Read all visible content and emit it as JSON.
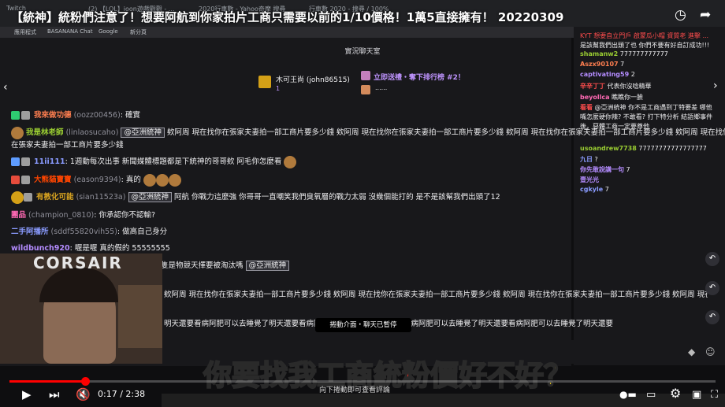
{
  "video": {
    "title": "【統神】統粉們注意了！想要阿航到你家拍片工商只需要以前的1/10價格！1萬5直接擁有！ 20220309",
    "caption_part1": "你要找我工商",
    "caption_red": "統粉",
    "caption_part2": "價好不好？",
    "subtitle": "向下捲動即可查看評論",
    "time_current": "0:17",
    "time_total": "2:38",
    "progress_fraction": 0.107,
    "brand": "CORSAIR",
    "accent": "#ff0000"
  },
  "browser": {
    "tabs": [
      "Twitch",
      "(2) 【LOL】ioon遊戲觀觀 - ...",
      "2020行車數 - Yahoo奇摩 搜尋",
      "行車數 2020 - 搜尋 / 100%"
    ],
    "bookmarks": [
      "應用程式",
      "BASANANA Chat",
      "Google",
      "新分頁"
    ]
  },
  "chat": {
    "header": "實況聊天室",
    "hype_name": "木可王尚 (john86515)",
    "hype_count": "1",
    "hype_cta": "立即送禮・奪下排行榜 #2！",
    "hype_more": "......",
    "paused_label": "捲動介面・聊天已暫停",
    "messages": [
      {
        "user": "我來做功德",
        "handle": "(oozz00456)",
        "text": ": 確實",
        "color": "#ff7f50"
      },
      {
        "user": "我是林老師",
        "handle": "(linlaosucaho)",
        "text": "欸阿周 現在找你在張家夫妻拍一部工商片要多少錢 欸阿周 現在找你在張家夫妻拍一部工商片要多少錢 欸阿周 現在找你在張家夫妻拍一部工商片要多少錢 欸阿周 現在找你",
        "mention": "@亞洲統神",
        "color": "#9acd32"
      },
      {
        "text2": "在張家夫妻拍一部工商片要多少錢"
      },
      {
        "user": "11ii111",
        "handle": "",
        "text": ": 1週動每次出事 新聞媒體標題都是下統神的哥哥欸 阿毛你怎麼看",
        "color": "#8a9bff"
      },
      {
        "user": "大熊貓寶寶",
        "handle": "(eason9394)",
        "text": ": 真的",
        "color": "#ff4500"
      },
      {
        "user": "有教化可能",
        "handle": "(sian11523a)",
        "text": "阿航 你戰力這麼強 你哥哥一直嘲笑我們臭氧層的戰力太弱 沒幾個能打的 是不是該幫我們出頭了12",
        "mention": "@亞洲統神",
        "color": "#daa520"
      },
      {
        "user": "團品",
        "handle": "(champion_0810)",
        "text": ": 你承認你不認輸?",
        "color": "#ff69b4"
      },
      {
        "user": "二手阿播所",
        "handle": "(sddf55820vih55)",
        "text": ": 做高自己身分",
        "color": "#8a9bff"
      },
      {
        "user": "wildbunch920",
        "handle": "",
        "text": ": 喔是喔 真的假的 55555555",
        "color": "#b48cff"
      },
      {
        "text3": "以精蟲剩8隻是物競天擇要被淘汰嗎",
        "mention": "@亞洲統神"
      },
      {
        "text4": "欸阿周 現在找你在張家夫妻拍一部工商片要多少錢 欸阿周 現在找你在張家夫妻拍一部工商片要多少錢 欸阿周 現在找你在張家夫妻拍一部工商片要多少錢 欸阿周 現在找"
      },
      {
        "text5": "明天還要看病阿肥可以去睡覺了明天還要看病阿肥可以去睡覺了明天還要看病阿肥可以去睡覺了明天還要看病阿肥可以去睡覺了明天還要"
      }
    ]
  },
  "right_chat": {
    "messages": [
      {
        "user": "",
        "text": "KYT 想要自立門戶 啟蒙瓜小帽 資質老 進擊 ...",
        "color": "#ff4d4d"
      },
      {
        "user": "",
        "text": "是該幫我們出頭了也 你們不要有好自訂成功!!!",
        "color": "#efeff1"
      },
      {
        "user": "shamanw2",
        "text": "777777777777",
        "color": "#9acd32"
      },
      {
        "user": "Aszx90107",
        "text": "7",
        "color": "#ff7f50"
      },
      {
        "user": "captivating59",
        "text": "2",
        "color": "#b48cff"
      },
      {
        "user": "辛辛丁丁",
        "text": "代表你沒唸精華",
        "color": "#ff4d4d"
      },
      {
        "user": "beyollca",
        "text": "瞧瞧你一臉",
        "color": "#ff69b4"
      },
      {
        "user": "看看",
        "text": "@亞洲統神 你不是工商遇到丁特要差 哪他嘴怎麼硬你辣? 不敢看? 打下特分析 結語鄉事件後，惡體工商一定要尊他",
        "color": "#ff4d4d"
      },
      {
        "user": "usoandrew7738",
        "text": "77777777777777777",
        "color": "#9acd32"
      },
      {
        "user": "九日",
        "text": "?",
        "color": "#8a9bff"
      },
      {
        "user": "你先敢說講一句",
        "text": "7",
        "color": "#b48cff"
      },
      {
        "user": "壹光光",
        "text": "",
        "color": "#b48cff"
      },
      {
        "user": "cgkyle",
        "text": "7",
        "color": "#8a9bff"
      }
    ]
  },
  "icons": {
    "clock": "clock-icon",
    "share": "share-icon",
    "play": "play-icon",
    "next": "next-icon",
    "mute": "mute-icon",
    "settings": "gear-icon",
    "fullscreen": "fullscreen-icon"
  }
}
